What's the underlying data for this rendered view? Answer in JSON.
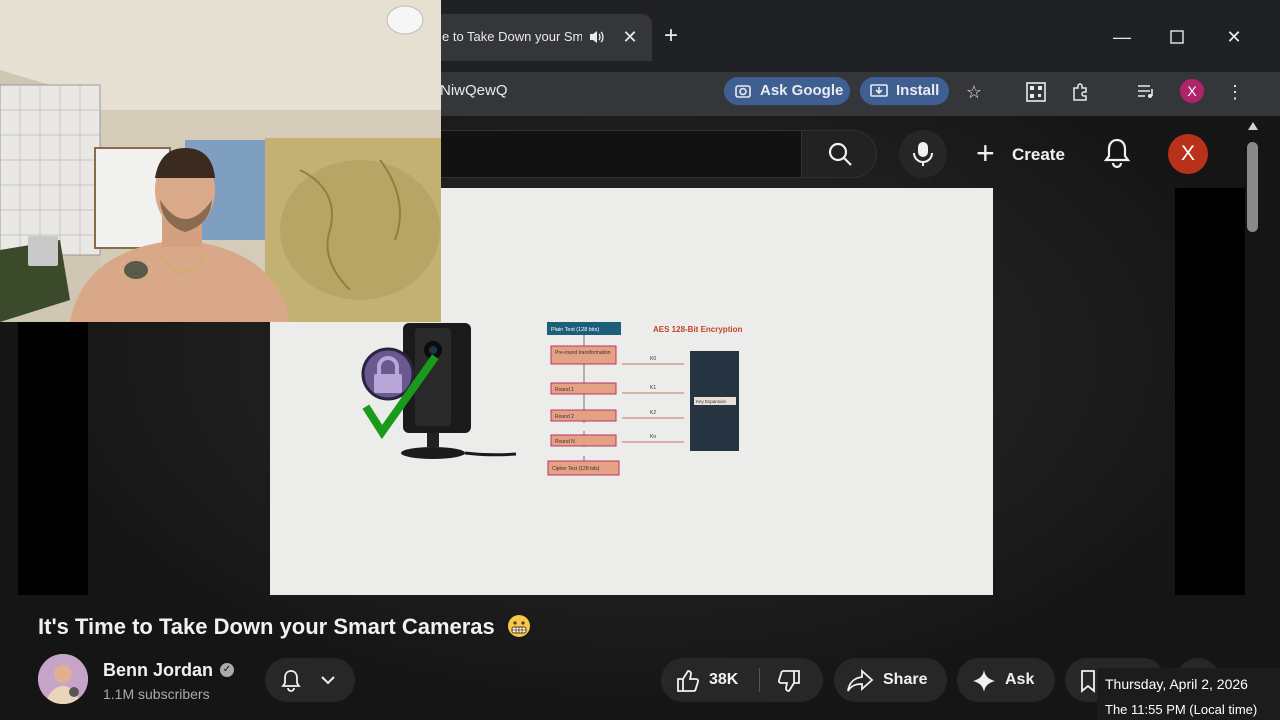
{
  "browser": {
    "tab_title": "e to Take Down your Sm",
    "new_tab": "+",
    "url_fragment": "NiwQewQ",
    "ask_google": "Ask Google",
    "install": "Install",
    "profile_initial": "X",
    "window_controls": [
      "minimize-icon",
      "maximize-icon",
      "close-icon"
    ]
  },
  "youtube": {
    "create_label": "Create",
    "avatar_initial": "X",
    "video_title": "It's Time to Take Down your Smart Cameras",
    "channel_name": "Benn Jordan",
    "subscribers": "1.1M subscribers",
    "likes": "38K",
    "share": "Share",
    "ask": "Ask"
  },
  "diagram": {
    "title": "AES 128-Bit Encryption",
    "input": "Plain Text (128 bits)",
    "steps": [
      "Pre-round transformation",
      "Round 1",
      "Round 2",
      "Round N"
    ],
    "keys": [
      "K0",
      "K1",
      "K2",
      "Kn"
    ],
    "key_expansion": "Key Expansion",
    "output": "Cipher Text (128 bits)"
  },
  "tooltip": {
    "date": "Thursday, April 2, 2026",
    "time": "The 11:55 PM (Local time)"
  },
  "colors": {
    "accent": "#3f5f93",
    "avatar": "#b8321b",
    "diagram_step": "#e4a184",
    "diagram_title": "#c0452a",
    "diagram_input": "#1d5f7a",
    "diagram_key_box": "#263340"
  }
}
